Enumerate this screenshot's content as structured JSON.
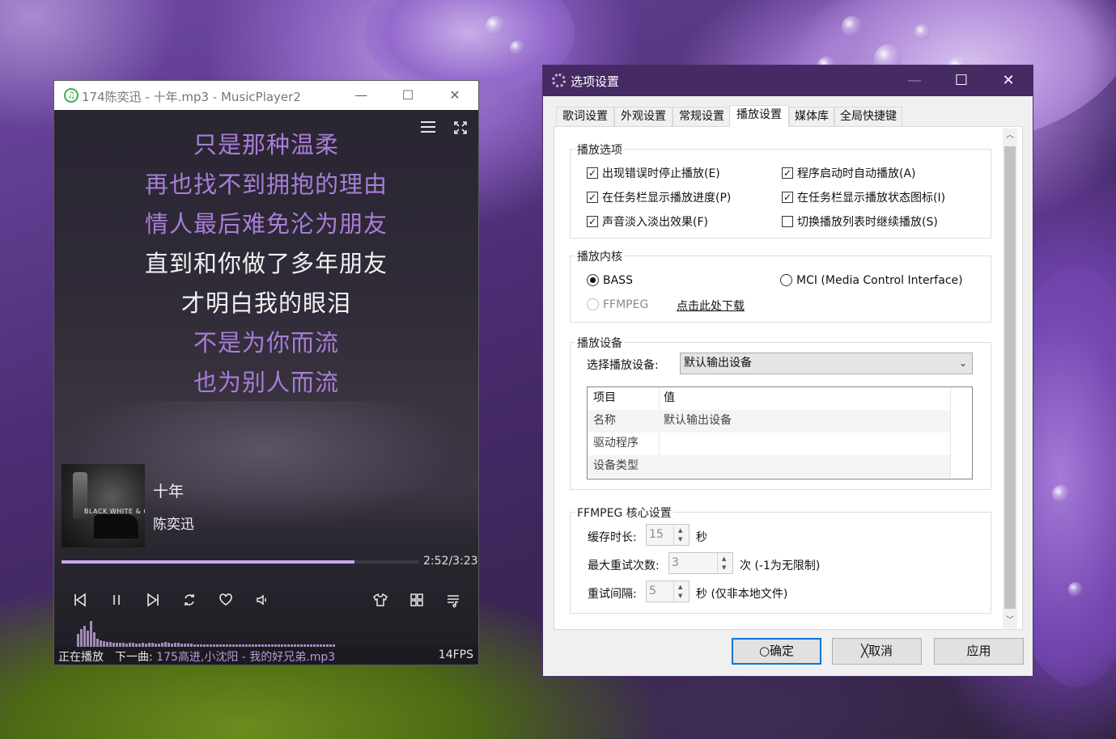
{
  "player": {
    "window_title": "174陈奕迅 - 十年.mp3 - MusicPlayer2",
    "app_icon": "music-note-icon",
    "lyrics": [
      {
        "text": "只是那种温柔",
        "state": "dim"
      },
      {
        "text": "再也找不到拥抱的理由",
        "state": "dim"
      },
      {
        "text": "情人最后难免沦为朋友",
        "state": "dim"
      },
      {
        "text": "直到和你做了多年朋友",
        "state": "current"
      },
      {
        "text": "才明白我的眼泪",
        "state": "current"
      },
      {
        "text": "不是为你而流",
        "state": "dim"
      },
      {
        "text": "也为别人而流",
        "state": "dim"
      }
    ],
    "album_art_text": "BLACK WHITE & GRAY",
    "song_title": "十年",
    "artist": "陈奕迅",
    "progress_fraction": 0.82,
    "time": "2:52/3:23",
    "status_left": "正在播放",
    "next_label": "下一曲:",
    "next_track": "175高进,小沈阳 - 我的好兄弟.mp3",
    "fps": "14FPS",
    "accent_color": "#a77ed6",
    "controls": [
      "previous-icon",
      "pause-icon",
      "next-icon",
      "repeat-icon",
      "favorite-icon",
      "volume-icon",
      "skin-icon",
      "layout-icon",
      "playlist-icon"
    ]
  },
  "dialog": {
    "title": "选项设置",
    "tabs": [
      {
        "label": "歌词设置",
        "active": false
      },
      {
        "label": "外观设置",
        "active": false
      },
      {
        "label": "常规设置",
        "active": false
      },
      {
        "label": "播放设置",
        "active": true
      },
      {
        "label": "媒体库",
        "active": false
      },
      {
        "label": "全局快捷键",
        "active": false
      }
    ],
    "play_options": {
      "label": "播放选项",
      "items": [
        {
          "label": "出现错误时停止播放(E)",
          "checked": true
        },
        {
          "label": "程序启动时自动播放(A)",
          "checked": true
        },
        {
          "label": "在任务栏显示播放进度(P)",
          "checked": true
        },
        {
          "label": "在任务栏显示播放状态图标(I)",
          "checked": true
        },
        {
          "label": "声音淡入淡出效果(F)",
          "checked": true
        },
        {
          "label": "切换播放列表时继续播放(S)",
          "checked": false
        }
      ]
    },
    "core": {
      "label": "播放内核",
      "bass": "BASS",
      "mci": "MCI (Media Control Interface)",
      "ffmpeg": "FFMPEG",
      "download_link": "点击此处下载",
      "selected": "BASS"
    },
    "device": {
      "label": "播放设备",
      "select_label": "选择播放设备:",
      "selected": "默认输出设备",
      "columns": [
        "项目",
        "值"
      ],
      "rows": [
        {
          "key": "名称",
          "value": "默认输出设备"
        },
        {
          "key": "驱动程序",
          "value": ""
        },
        {
          "key": "设备类型",
          "value": ""
        }
      ]
    },
    "ffmpeg": {
      "label": "FFMPEG 核心设置",
      "cache_label": "缓存时长:",
      "cache_value": "15",
      "cache_unit": "秒",
      "retry_label": "最大重试次数:",
      "retry_value": "3",
      "retry_unit": "次  (-1为无限制)",
      "interval_label": "重试间隔:",
      "interval_value": "5",
      "interval_unit": "秒  (仅非本地文件)"
    },
    "buttons": {
      "ok": "确定",
      "cancel": "取消",
      "apply": "应用"
    }
  }
}
